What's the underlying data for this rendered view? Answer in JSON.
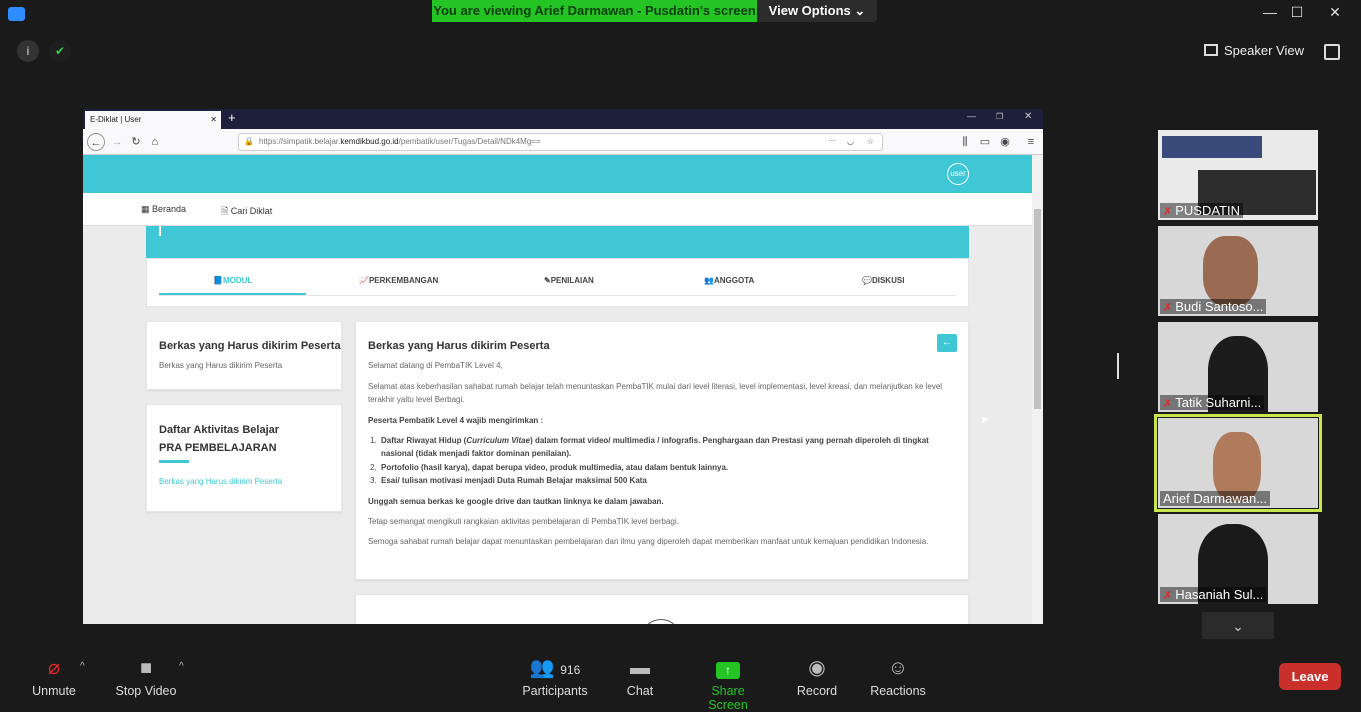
{
  "zoom": {
    "banner_text": "You are viewing Arief Darmawan - Pusdatin's screen",
    "view_options": "View Options",
    "speaker_view": "Speaker View",
    "icons": [
      "info-icon",
      "shield-check-icon",
      "grid-icon",
      "fullscreen-icon"
    ],
    "participants": [
      {
        "name": "PUSDATIN"
      },
      {
        "name": "Budi Santoso..."
      },
      {
        "name": "Tatik Suharni..."
      },
      {
        "name": "Arief Darmawan..."
      },
      {
        "name": "Hasaniah Sul..."
      }
    ],
    "toolbar": {
      "unmute": "Unmute",
      "stop_video": "Stop Video",
      "participants": "Participants",
      "participants_count": "916",
      "chat": "Chat",
      "share_screen": "Share Screen",
      "record": "Record",
      "reactions": "Reactions",
      "leave": "Leave"
    },
    "colors": {
      "banner": "#23c423",
      "share": "#23c423",
      "leave": "#c9302c",
      "active_border": "#c8e64a"
    }
  },
  "browser": {
    "tab_title": "E-Diklat | User",
    "url_prefix": "https://simpatik.belajar.",
    "url_domain": "kemdikbud.go.id",
    "url_path": "/pembatik/user/Tugas/Detail/NDk4Mg=="
  },
  "site": {
    "user_label": "user",
    "nav": {
      "beranda": "Beranda",
      "cari": "Cari Diklat"
    },
    "tabs": [
      "MODUL",
      "PERKEMBANGAN",
      "PENILAIAN",
      "ANGGOTA",
      "DISKUSI"
    ],
    "left_card1": {
      "title": "Berkas yang Harus dikirim Peserta",
      "text": "Berkas yang Harus dikirim Peserta"
    },
    "left_card2": {
      "title_line1": "Daftar Aktivitas Belajar",
      "title_line2": "PRA PEMBELAJARAN",
      "link": "Berkas yang Harus dikirim Peserta"
    },
    "content": {
      "title": "Berkas yang Harus dikirim Peserta",
      "greeting": "Selamat datang di PembaTIK Level 4,",
      "para1": "Selamat atas keberhasilan sahabat rumah belajar telah menuntaskan PembaTIK mulai dari level literasi, level implementasi, level kreasi, dan melanjutkan ke level terakhir yaitu level Berbagi.",
      "must_send": "Peserta Pembatik Level 4 wajib mengirimkan :",
      "item1_a": "Daftar Riwayat Hidup (",
      "item1_b": "Curriculum Vitae",
      "item1_c": ") dalam format video/ multimedia / infografis. Penghargaan dan Prestasi yang pernah diperoleh di tingkat nasional (tidak menjadi faktor dominan penilaian).",
      "item2": "Portofolio (hasil karya), dapat berupa video, produk multimedia, atau dalam bentuk lainnya.",
      "item3": "Esai/ tulisan motivasi menjadi Duta Rumah Belajar maksimal 500 Kata",
      "upload": "Unggah semua berkas ke google drive dan tautkan linknya ke dalam jawaban.",
      "para2": "Tetap semangat mengikuti rangkaian aktivitas pembelajaran di PembaTIK level berbagi.",
      "para3": "Semoga sahabat rumah belajar dapat menuntaskan pembelajaran dan ilmu yang diperoleh dapat memberikan manfaat untuk kemajuan pendidikan Indonesia."
    },
    "accent": "#3fc7d6"
  }
}
